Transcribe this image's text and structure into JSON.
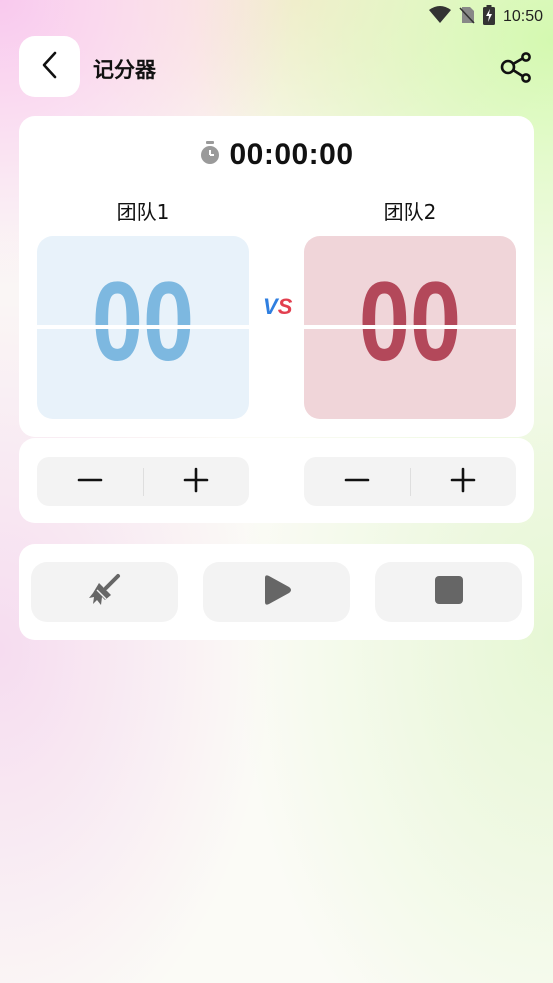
{
  "status_bar": {
    "time": "10:50"
  },
  "header": {
    "title": "记分器"
  },
  "timer": {
    "value": "00:00:00"
  },
  "teams": [
    {
      "name": "团队1",
      "score": "00",
      "color": "#7db8e0",
      "panel_bg": "#e8f2fa"
    },
    {
      "name": "团队2",
      "score": "00",
      "color": "#b3485a",
      "panel_bg": "#f0d5d9"
    }
  ],
  "vs": {
    "v": "V",
    "s": "S"
  },
  "actions": [
    "broom-icon",
    "play-icon",
    "stop-icon"
  ]
}
